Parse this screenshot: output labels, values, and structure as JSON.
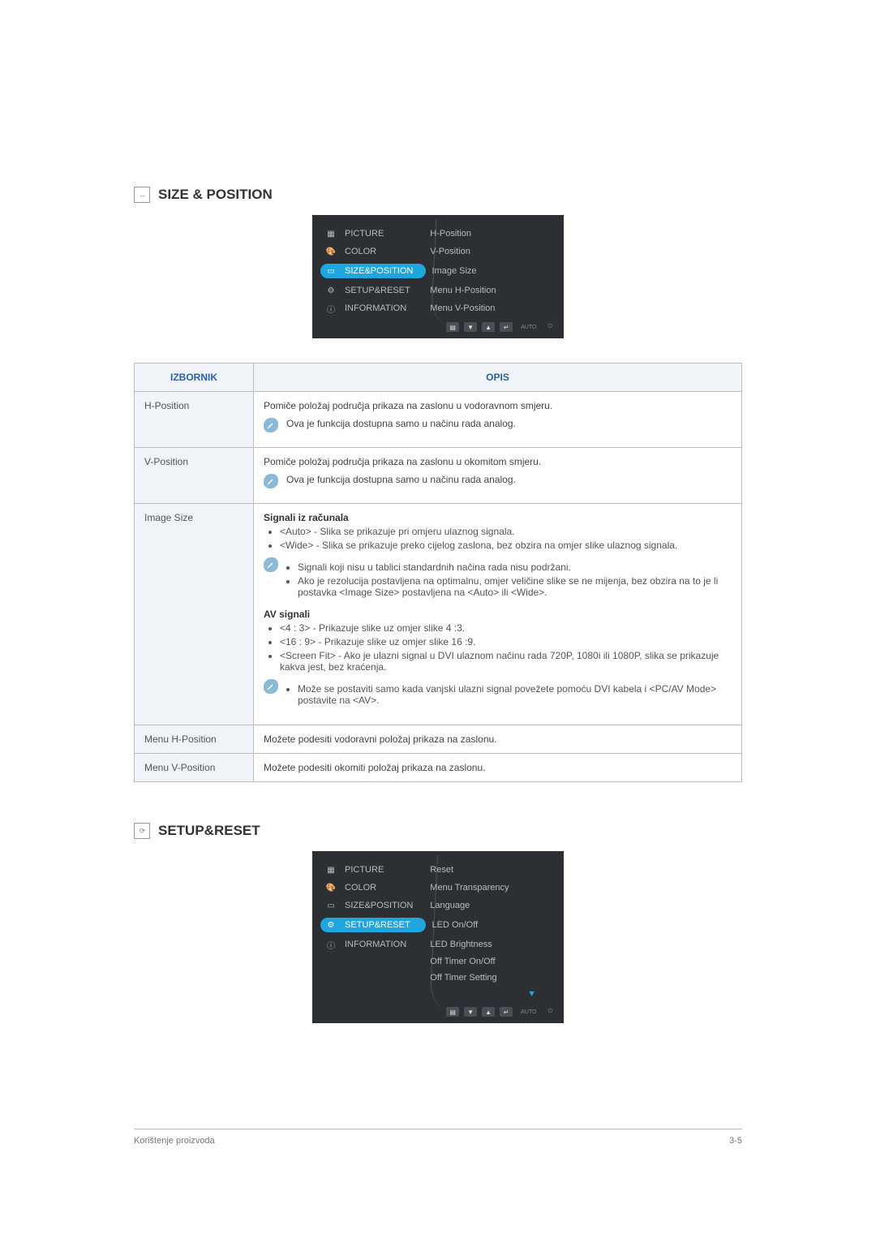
{
  "sections": {
    "sp_title": "SIZE & POSITION",
    "sr_title": "SETUP&RESET"
  },
  "osd1": {
    "left": [
      "PICTURE",
      "COLOR",
      "SIZE&POSITION",
      "SETUP&RESET",
      "INFORMATION"
    ],
    "right": [
      "H-Position",
      "V-Position",
      "Image Size",
      "Menu H-Position",
      "Menu V-Position"
    ],
    "footer_auto": "AUTO"
  },
  "osd2": {
    "left": [
      "PICTURE",
      "COLOR",
      "SIZE&POSITION",
      "SETUP&RESET",
      "INFORMATION"
    ],
    "right": [
      "Reset",
      "Menu Transparency",
      "Language",
      "LED On/Off",
      "LED Brightness",
      "Off Timer On/Off",
      "Off Timer Setting"
    ],
    "footer_auto": "AUTO"
  },
  "table_head": {
    "c1": "IZBORNIK",
    "c2": "OPIS"
  },
  "rows": {
    "hpos": {
      "name": "H-Position",
      "desc": "Pomiče položaj područja prikaza na zaslonu u vodoravnom smjeru.",
      "note": "Ova je funkcija dostupna samo u načinu rada analog."
    },
    "vpos": {
      "name": "V-Position",
      "desc": "Pomiče položaj područja prikaza na zaslonu u okomitom smjeru.",
      "note": "Ova je funkcija dostupna samo u načinu rada analog."
    },
    "img": {
      "name": "Image Size",
      "h1": "Signali iz računala",
      "b1": "<Auto> - Slika se prikazuje pri omjeru ulaznog signala.",
      "b2": "<Wide> - Slika se prikazuje preko cijelog zaslona, bez obzira na omjer slike ulaznog signala.",
      "n1": "Signali koji nisu u tablici standardnih načina rada nisu podržani.",
      "n2": "Ako je rezolucija postavljena na optimalnu, omjer veličine slike se ne mijenja, bez obzira na to je li postavka <Image Size> postavljena na <Auto> ili <Wide>.",
      "h2": "AV signali",
      "b3": "<4 : 3> - Prikazuje slike uz omjer slike 4 :3.",
      "b4": "<16 : 9> - Prikazuje slike uz omjer slike 16 :9.",
      "b5": "<Screen Fit> - Ako je ulazni signal u DVI ulaznom načinu rada 720P, 1080i ili 1080P, slika se prikazuje kakva jest, bez kraćenja.",
      "n3": "Može se postaviti samo kada vanjski ulazni signal povežete pomoću DVI kabela i <PC/AV Mode> postavite na <AV>."
    },
    "mh": {
      "name": "Menu H-Position",
      "desc": "Možete podesiti vodoravni položaj prikaza na zaslonu."
    },
    "mv": {
      "name": "Menu V-Position",
      "desc": "Možete podesiti okomiti položaj prikaza na zaslonu."
    }
  },
  "footer": {
    "left": "Korištenje proizvoda",
    "right": "3-5"
  }
}
